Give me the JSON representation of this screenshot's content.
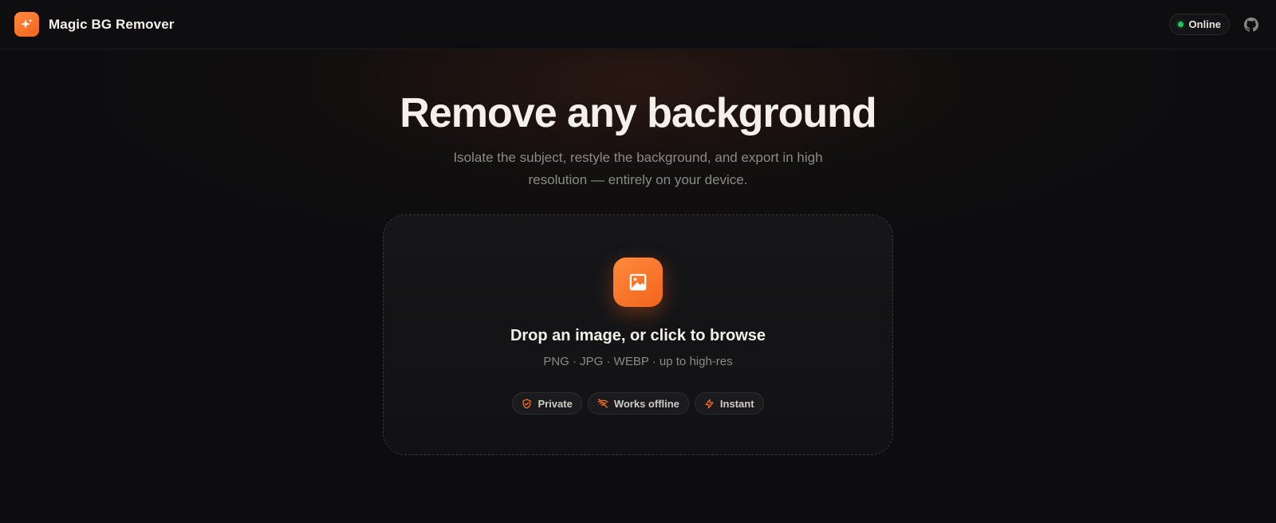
{
  "app": {
    "name": "Magic BG Remover",
    "logo_icon": "sparkle-icon",
    "accent": "#f47022"
  },
  "header": {
    "status_label": "Online",
    "status_color": "#22c55e",
    "github_icon": "github-icon"
  },
  "hero": {
    "title": "Remove any background",
    "subtitle": "Isolate the subject, restyle the background, and export in high resolution — entirely on your device."
  },
  "dropzone": {
    "icon": "image-icon",
    "title": "Drop an image, or click to browse",
    "hint": "PNG · JPG · WEBP · up to high-res",
    "features": [
      {
        "icon": "shield-check-icon",
        "label": "Private"
      },
      {
        "icon": "wifi-off-icon",
        "label": "Works offline"
      },
      {
        "icon": "lightning-icon",
        "label": "Instant"
      }
    ]
  }
}
